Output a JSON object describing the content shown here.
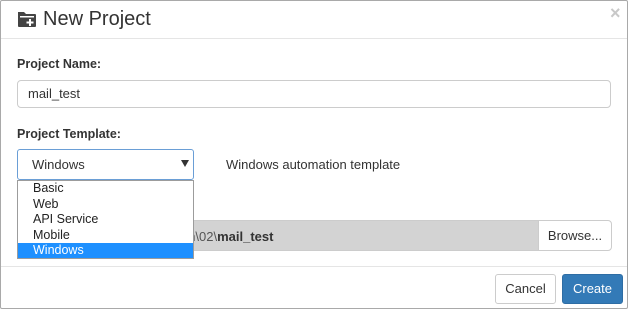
{
  "dialog": {
    "title": "New Project",
    "close_glyph": "×"
  },
  "project_name": {
    "label": "Project Name:",
    "value": "mail_test"
  },
  "project_template": {
    "label": "Project Template:",
    "selected": "Windows",
    "description": "Windows automation template",
    "options": [
      "Basic",
      "Web",
      "API Service",
      "Mobile",
      "Windows"
    ],
    "selected_index": 4
  },
  "location": {
    "path_visible_prefix": "nation\\02\\",
    "path_visible_name": "mail_test",
    "browse_label": "Browse..."
  },
  "footer": {
    "cancel_label": "Cancel",
    "create_label": "Create"
  },
  "colors": {
    "primary": "#337ab7",
    "selection": "#1e90ff",
    "path_field_bg": "#d3d3d3"
  },
  "icons": {
    "title_icon": "folder-plus-icon",
    "dropdown_icon": "caret-down-icon"
  }
}
